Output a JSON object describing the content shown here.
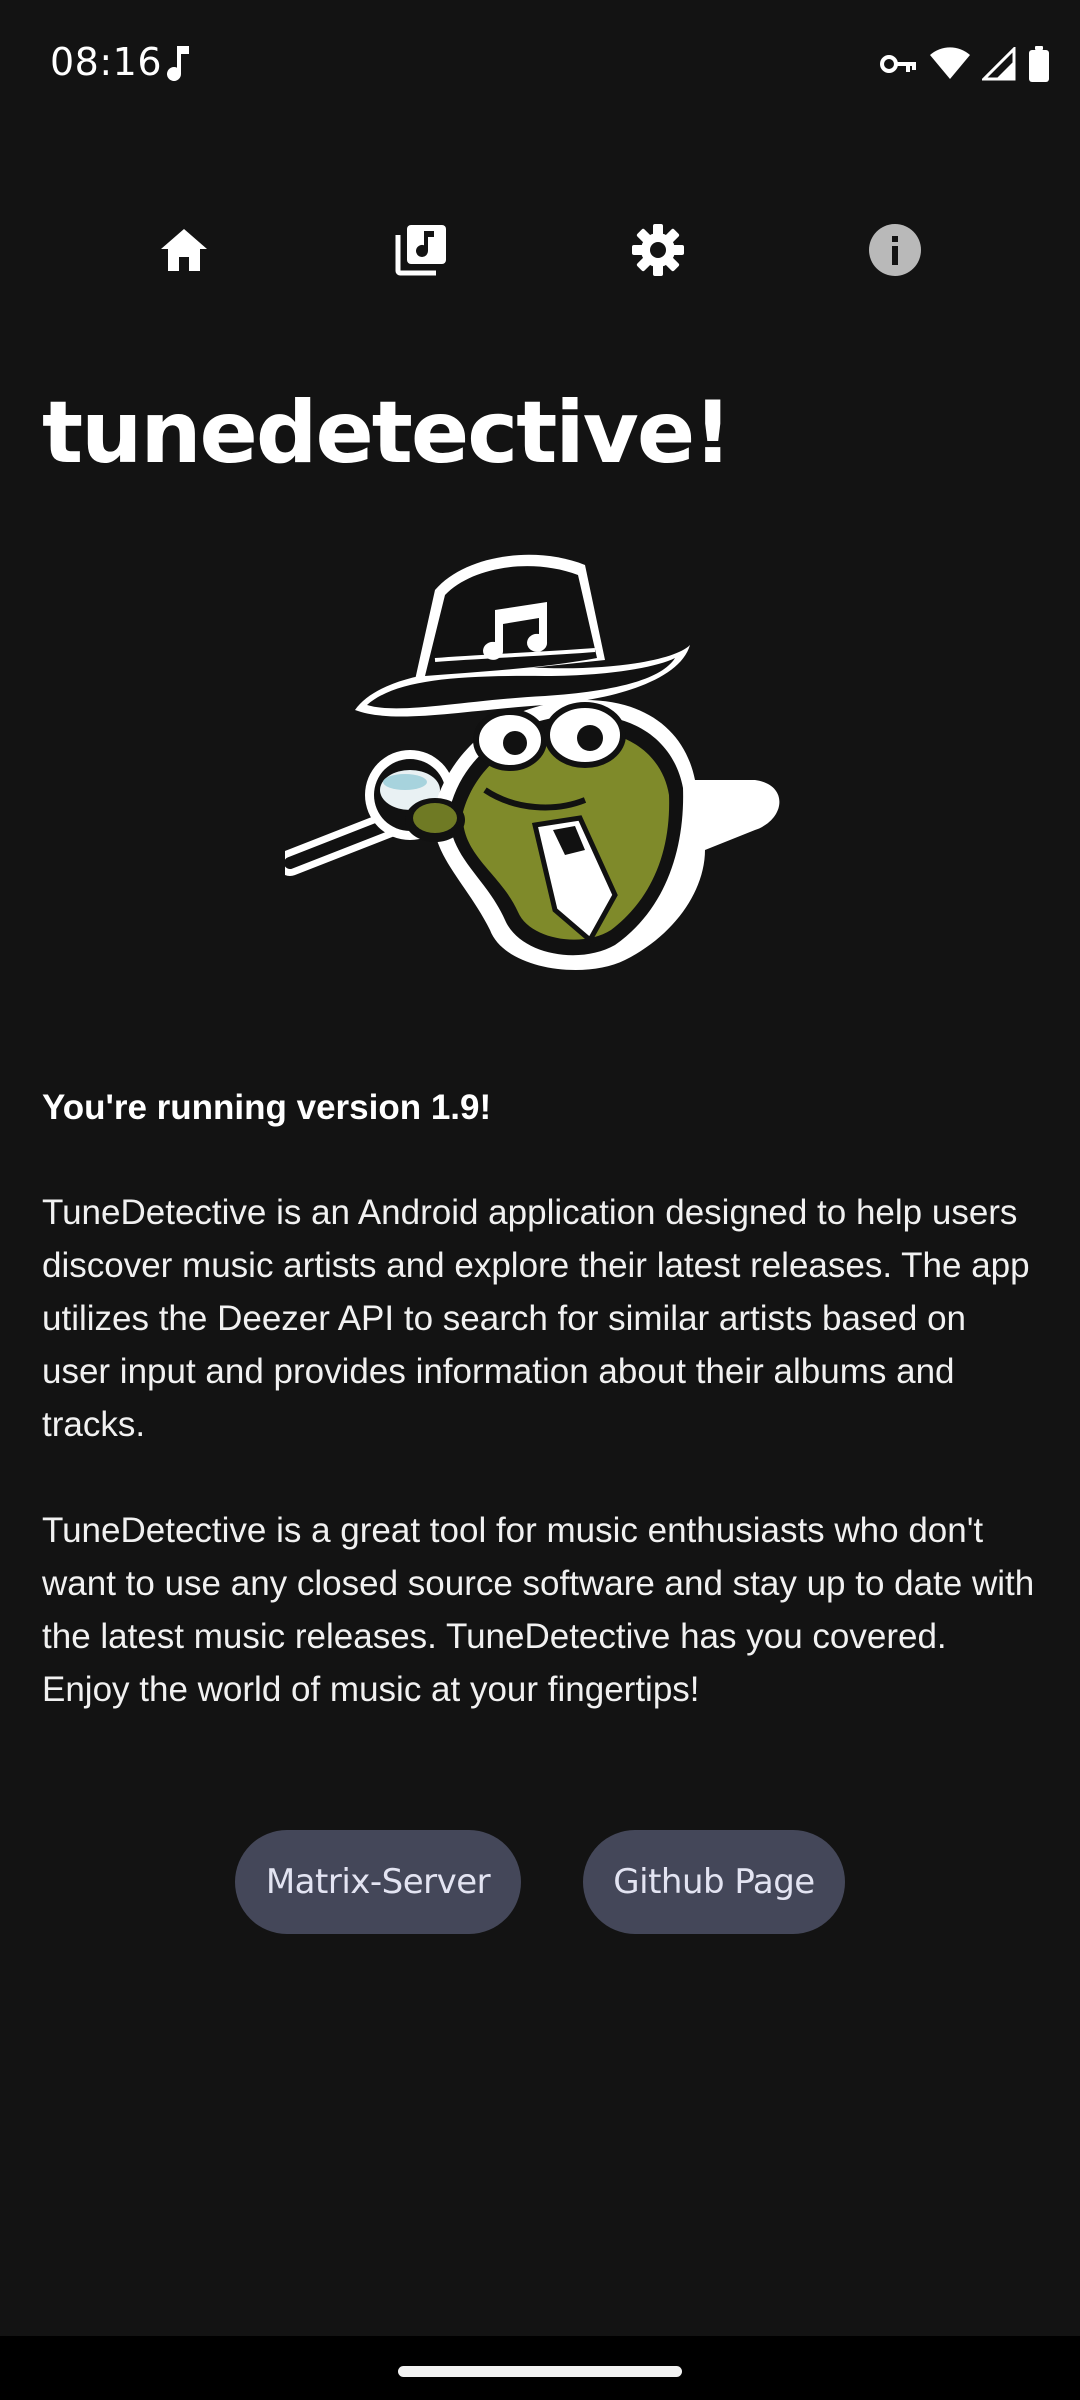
{
  "status_bar": {
    "time": "08:16",
    "icons": [
      "music-note-icon",
      "vpn-key-icon",
      "wifi-icon",
      "cellular-signal-icon",
      "battery-icon"
    ]
  },
  "nav": {
    "items": [
      {
        "icon": "home-icon"
      },
      {
        "icon": "music-library-icon"
      },
      {
        "icon": "gear-icon"
      },
      {
        "icon": "info-icon"
      }
    ]
  },
  "title": "tunedetective!",
  "mascot": {
    "icon": "detective-frog-mascot"
  },
  "version_text": "You're running version 1.9!",
  "paragraphs": [
    "TuneDetective is an Android application designed to help users discover music artists and explore their latest releases. The app utilizes the Deezer API to search for similar artists based on user input and provides information about their albums and tracks.",
    "TuneDetective is a great tool for music enthusiasts who don't want to use any closed source software and stay up to date with the latest music releases. TuneDetective has you covered. Enjoy the world of music at your fingertips!"
  ],
  "buttons": {
    "matrix": "Matrix-Server",
    "github": "Github Page"
  },
  "colors": {
    "background": "#131313",
    "button_bg": "#444759",
    "button_text": "#e3e4f2",
    "text": "#ffffff"
  }
}
